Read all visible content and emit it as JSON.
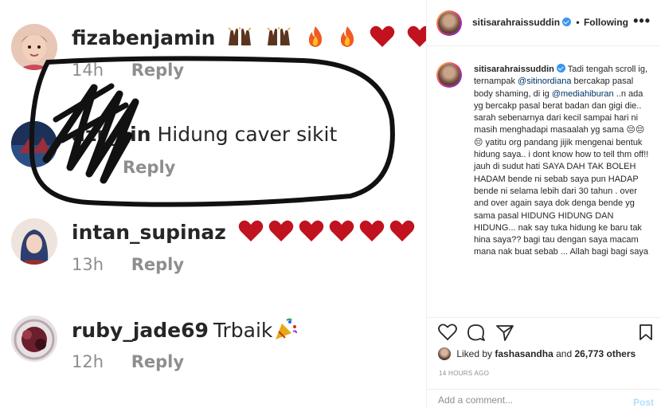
{
  "comments": [
    {
      "username": "fizabenjamin",
      "text": "",
      "time": "14h",
      "reply": "Reply"
    },
    {
      "username": "azr_ain",
      "text": "Hidung caver sikit",
      "time": "",
      "reply": "Reply"
    },
    {
      "username": "intan_supinaz",
      "text": "",
      "time": "13h",
      "reply": "Reply"
    },
    {
      "username": "ruby_jade69",
      "text": "Trbaik",
      "time": "12h",
      "reply": "Reply"
    }
  ],
  "header": {
    "username": "sitisarahraissuddin",
    "separator": "•",
    "follow_status": "Following",
    "more": "•••"
  },
  "caption": {
    "username": "sitisarahraissuddin",
    "part1": "Tadi tengah scroll ig, ternampak",
    "mention1": "@sitinordiana",
    "part2": "bercakap pasal body shaming, di ig",
    "mention2": "@mediahiburan",
    "part3": "..n ada yg bercakp pasal berat badan dan gigi die.. sarah sebenarnya dari kecil sampai hari ni masih menghadapi masaalah yg sama 😔😔😔 yatitu org pandang jijik mengenai bentuk hidung saya.. i dont know how to tell thm off!! jauh di sudut hati SAYA DAH TAK BOLEH HADAM bende ni sebab saya pun HADAP bende ni selama lebih dari 30 tahun . over and over again saya dok denga bende yg sama pasal HIDUNG HIDUNG DAN HIDUNG... nak say tuka hidung ke baru tak hina saya?? bagi tau dengan saya macam mana nak buat sebab ... Allah bagi bagi saya"
  },
  "likes": {
    "prefix": "Liked by",
    "user": "fashasandha",
    "and": "and",
    "count": "26,773 others"
  },
  "timestamp": "14 HOURS AGO",
  "add_comment": {
    "placeholder": "Add a comment...",
    "post_label": "Post"
  },
  "colors": {
    "accent": "#3897f0",
    "post_disabled": "#b2dffc",
    "heart": "#c1121f",
    "fire": "#f15a24"
  },
  "icons": [
    "heart-icon",
    "comment-icon",
    "share-icon",
    "bookmark-icon",
    "verified-icon",
    "fire-icon",
    "raised-hands-icon",
    "party-popper-icon"
  ]
}
